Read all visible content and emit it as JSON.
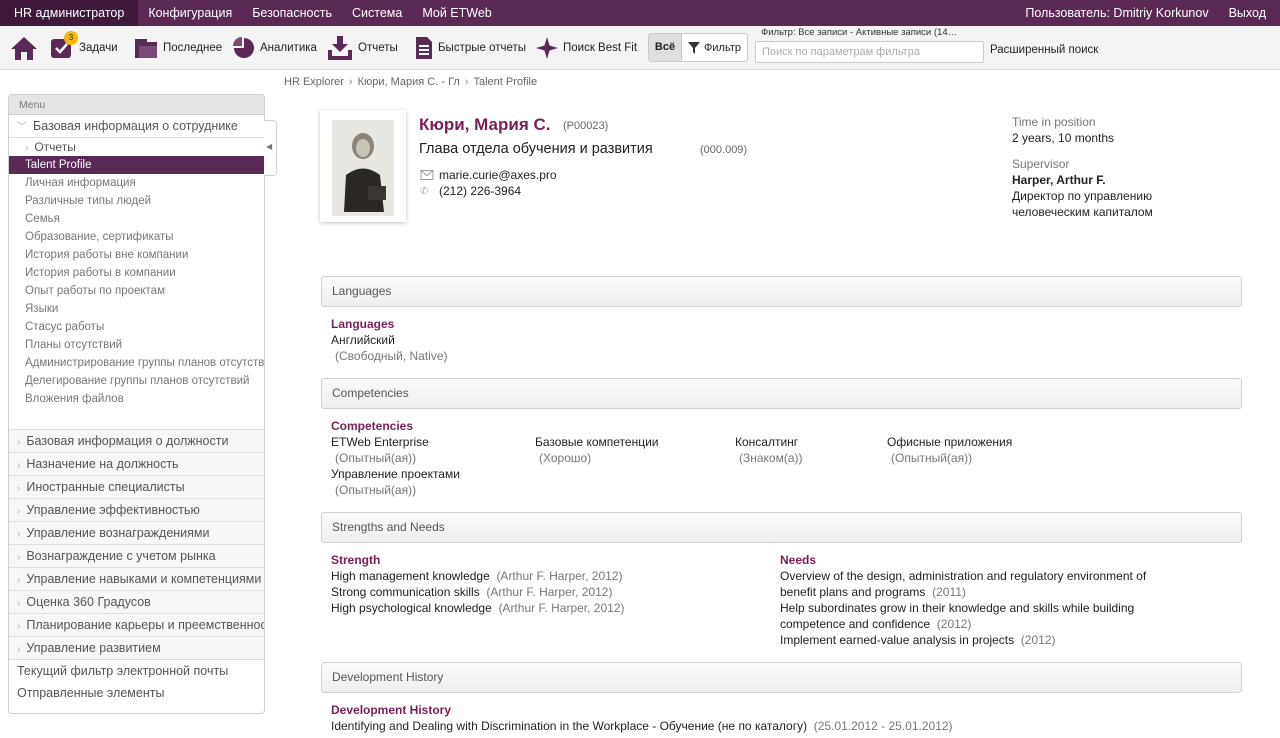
{
  "nav": {
    "items": [
      "HR администратор",
      "Конфигурация",
      "Безопасность",
      "Система",
      "Мой ETWeb"
    ],
    "user": "Пользователь: Dmitriy Korkunov",
    "logout": "Выход"
  },
  "toolbar": {
    "home_icon": "home-icon",
    "tasks": "Задачи",
    "tasks_badge": "3",
    "recent": "Последнее",
    "analytics": "Аналитика",
    "reports": "Отчеты",
    "quick_reports": "Быстрые отчеты",
    "best_fit": "Поиск Best Fit",
    "all": "Всё",
    "filter": "Фильтр",
    "filter_caption": "Фильтр: Все записи - Активные записи (14…",
    "filter_placeholder": "Поиск по параметрам фильтра",
    "advanced": "Расширенный поиск"
  },
  "breadcrumb": [
    "HR Explorer",
    "Кюри, Мария С. - Гл",
    "Talent Profile"
  ],
  "sidebar": {
    "title": "Menu",
    "open_category": "Базовая информация о сотруднике",
    "sub_group": "Отчеты",
    "items": [
      "Talent Profile",
      "Личная информация",
      "Различные типы людей",
      "Семья",
      "Образование, сертификаты",
      "История работы вне компании",
      "История работы в компании",
      "Опыт работы по проектам",
      "Языки",
      "Стасус работы",
      "Планы отсутствий",
      "Администрирование группы планов отсутствий",
      "Делегирование группы планов отсутствий",
      "Вложения файлов"
    ],
    "selected_index": 0,
    "categories": [
      "Базовая информация о должности",
      "Назначение на должность",
      "Иностранные специалисты",
      "Управление эффективностью",
      "Управление вознаграждениями",
      "Вознаграждение с учетом рынка",
      "Управление навыками и компетенциями",
      "Оценка 360 Градусов",
      "Планирование карьеры и преемственности",
      "Управление развитием"
    ],
    "extras": [
      "Текущий фильтр электронной почты",
      "Отправленные элементы"
    ]
  },
  "profile": {
    "name": "Кюри, Мария С.",
    "id": "(P00023)",
    "position": "Глава отдела обучения и развития",
    "position_code": "(000.009)",
    "email": "marie.curie@axes.pro",
    "phone": "(212) 226-3964",
    "time_label": "Time in position",
    "time_value": "2 years, 10 months",
    "supervisor_label": "Supervisor",
    "supervisor_name": "Harper, Arthur F.",
    "supervisor_title_1": "Директор по управлению",
    "supervisor_title_2": "человеческим капиталом"
  },
  "languages": {
    "header": "Languages",
    "title": "Languages",
    "name": "Английский",
    "level": "(Свободный, Native)"
  },
  "competencies": {
    "header": "Competencies",
    "title": "Competencies",
    "items": [
      {
        "name": "ETWeb Enterprise",
        "level": "(Опытный(ая))"
      },
      {
        "name": "Базовые компетенции",
        "level": "(Хорошо)"
      },
      {
        "name": "Консалтинг",
        "level": "(Знаком(а))"
      },
      {
        "name": "Офисные приложения",
        "level": "(Опытный(ая))"
      },
      {
        "name": "Управление проектами",
        "level": "(Опытный(ая))"
      }
    ]
  },
  "strengths": {
    "header": "Strengths and Needs",
    "strength_title": "Strength",
    "strengths": [
      {
        "text": "High management knowledge",
        "meta": "(Arthur F. Harper, 2012)"
      },
      {
        "text": "Strong communication skills",
        "meta": "(Arthur F. Harper, 2012)"
      },
      {
        "text": "High psychological knowledge",
        "meta": "(Arthur F. Harper, 2012)"
      }
    ],
    "needs_title": "Needs",
    "needs": [
      {
        "line1": "Overview of the design, administration and regulatory environment of",
        "line2": "benefit plans and programs",
        "meta": "(2011)"
      },
      {
        "line1": "Help subordinates grow in their knowledge and skills while building",
        "line2": "competence and confidence",
        "meta": "(2012)"
      },
      {
        "line1": "Implement earned-value analysis in projects",
        "line2": "",
        "meta": "(2012)"
      }
    ]
  },
  "development": {
    "header": "Development History",
    "title": "Development History",
    "item": "Identifying and Dealing with Discrimination in the Workplace - Обучение (не по каталогу)",
    "dates": "(25.01.2012 - 25.01.2012)"
  },
  "colors": {
    "brand": "#5a2a55",
    "accent": "#7a1f55",
    "badge": "#f5b800"
  }
}
